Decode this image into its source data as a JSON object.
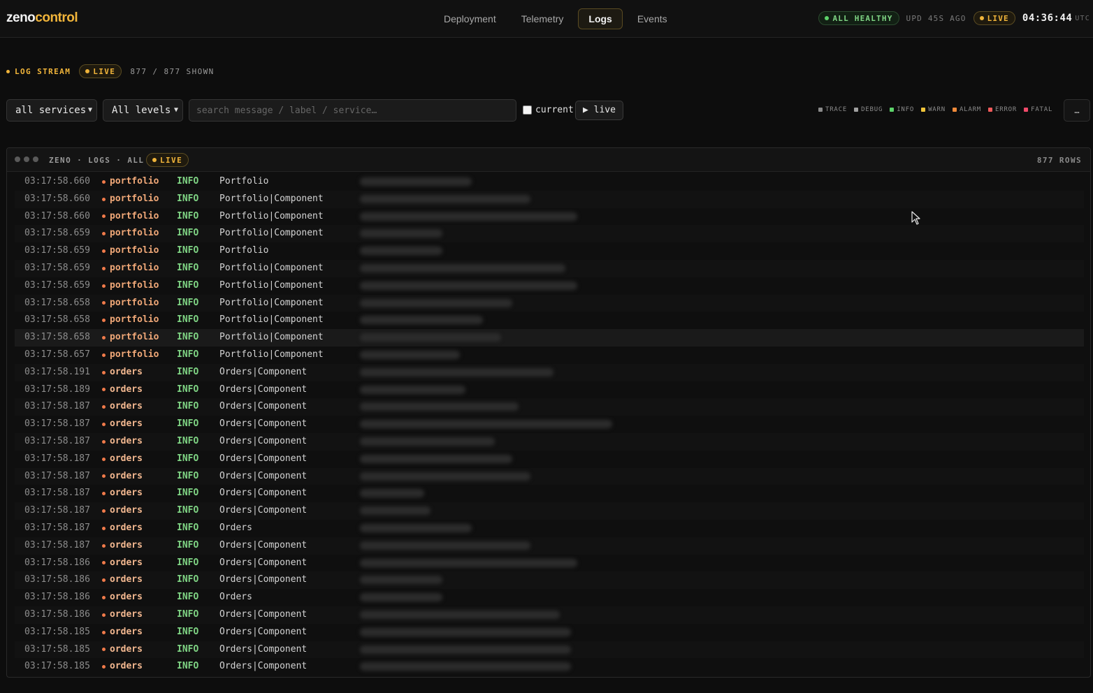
{
  "app": {
    "logo_a": "zeno",
    "logo_b": "control"
  },
  "nav": {
    "tabs": [
      {
        "label": "Deployment",
        "active": false
      },
      {
        "label": "Telemetry",
        "active": false
      },
      {
        "label": "Logs",
        "active": true
      },
      {
        "label": "Events",
        "active": false
      }
    ]
  },
  "status": {
    "health": "ALL HEALTHY",
    "updated": "UPD 45S AGO",
    "live": "LIVE",
    "clock": "04:36:44",
    "tz": "UTC"
  },
  "stream": {
    "title": "LOG STREAM",
    "live": "LIVE",
    "shown": "877 / 877 SHOWN"
  },
  "filters": {
    "service_value": "all services",
    "level_value": "All levels",
    "search_placeholder": "search message / label / service…",
    "current_label": "current",
    "live_button": "▶ live",
    "more_button": "…",
    "levels": [
      {
        "name": "TRACE",
        "color": "#8a8a8a"
      },
      {
        "name": "DEBUG",
        "color": "#a0a0a0"
      },
      {
        "name": "INFO",
        "color": "#5dd36a"
      },
      {
        "name": "WARN",
        "color": "#f0c43a"
      },
      {
        "name": "ALARM",
        "color": "#f08a3a"
      },
      {
        "name": "ERROR",
        "color": "#f05a5a"
      },
      {
        "name": "FATAL",
        "color": "#f04a6a"
      }
    ]
  },
  "panel": {
    "title": "ZENO · LOGS · ALL",
    "live": "LIVE",
    "rows_count": "877 ROWS"
  },
  "colors": {
    "portfolio": "#f0a878",
    "orders": "#f3b890",
    "dot": "#f07a4a"
  },
  "rows": [
    {
      "ts": "03:17:58.660",
      "service": "portfolio",
      "level": "INFO",
      "label": "Portfolio",
      "msg_len": 0.38
    },
    {
      "ts": "03:17:58.660",
      "service": "portfolio",
      "level": "INFO",
      "label": "Portfolio|Component",
      "msg_len": 0.58
    },
    {
      "ts": "03:17:58.660",
      "service": "portfolio",
      "level": "INFO",
      "label": "Portfolio|Component",
      "msg_len": 0.74
    },
    {
      "ts": "03:17:58.659",
      "service": "portfolio",
      "level": "INFO",
      "label": "Portfolio|Component",
      "msg_len": 0.28
    },
    {
      "ts": "03:17:58.659",
      "service": "portfolio",
      "level": "INFO",
      "label": "Portfolio",
      "msg_len": 0.28
    },
    {
      "ts": "03:17:58.659",
      "service": "portfolio",
      "level": "INFO",
      "label": "Portfolio|Component",
      "msg_len": 0.7
    },
    {
      "ts": "03:17:58.659",
      "service": "portfolio",
      "level": "INFO",
      "label": "Portfolio|Component",
      "msg_len": 0.74
    },
    {
      "ts": "03:17:58.658",
      "service": "portfolio",
      "level": "INFO",
      "label": "Portfolio|Component",
      "msg_len": 0.52
    },
    {
      "ts": "03:17:58.658",
      "service": "portfolio",
      "level": "INFO",
      "label": "Portfolio|Component",
      "msg_len": 0.42
    },
    {
      "ts": "03:17:58.658",
      "service": "portfolio",
      "level": "INFO",
      "label": "Portfolio|Component",
      "msg_len": 0.48
    },
    {
      "ts": "03:17:58.657",
      "service": "portfolio",
      "level": "INFO",
      "label": "Portfolio|Component",
      "msg_len": 0.34
    },
    {
      "ts": "03:17:58.191",
      "service": "orders",
      "level": "INFO",
      "label": "Orders|Component",
      "msg_len": 0.66
    },
    {
      "ts": "03:17:58.189",
      "service": "orders",
      "level": "INFO",
      "label": "Orders|Component",
      "msg_len": 0.36
    },
    {
      "ts": "03:17:58.187",
      "service": "orders",
      "level": "INFO",
      "label": "Orders|Component",
      "msg_len": 0.54
    },
    {
      "ts": "03:17:58.187",
      "service": "orders",
      "level": "INFO",
      "label": "Orders|Component",
      "msg_len": 0.86
    },
    {
      "ts": "03:17:58.187",
      "service": "orders",
      "level": "INFO",
      "label": "Orders|Component",
      "msg_len": 0.46
    },
    {
      "ts": "03:17:58.187",
      "service": "orders",
      "level": "INFO",
      "label": "Orders|Component",
      "msg_len": 0.52
    },
    {
      "ts": "03:17:58.187",
      "service": "orders",
      "level": "INFO",
      "label": "Orders|Component",
      "msg_len": 0.58
    },
    {
      "ts": "03:17:58.187",
      "service": "orders",
      "level": "INFO",
      "label": "Orders|Component",
      "msg_len": 0.22
    },
    {
      "ts": "03:17:58.187",
      "service": "orders",
      "level": "INFO",
      "label": "Orders|Component",
      "msg_len": 0.24
    },
    {
      "ts": "03:17:58.187",
      "service": "orders",
      "level": "INFO",
      "label": "Orders",
      "msg_len": 0.38
    },
    {
      "ts": "03:17:58.187",
      "service": "orders",
      "level": "INFO",
      "label": "Orders|Component",
      "msg_len": 0.58
    },
    {
      "ts": "03:17:58.186",
      "service": "orders",
      "level": "INFO",
      "label": "Orders|Component",
      "msg_len": 0.74
    },
    {
      "ts": "03:17:58.186",
      "service": "orders",
      "level": "INFO",
      "label": "Orders|Component",
      "msg_len": 0.28
    },
    {
      "ts": "03:17:58.186",
      "service": "orders",
      "level": "INFO",
      "label": "Orders",
      "msg_len": 0.28
    },
    {
      "ts": "03:17:58.186",
      "service": "orders",
      "level": "INFO",
      "label": "Orders|Component",
      "msg_len": 0.68
    },
    {
      "ts": "03:17:58.185",
      "service": "orders",
      "level": "INFO",
      "label": "Orders|Component",
      "msg_len": 0.72
    },
    {
      "ts": "03:17:58.185",
      "service": "orders",
      "level": "INFO",
      "label": "Orders|Component",
      "msg_len": 0.72
    },
    {
      "ts": "03:17:58.185",
      "service": "orders",
      "level": "INFO",
      "label": "Orders|Component",
      "msg_len": 0.72
    }
  ]
}
